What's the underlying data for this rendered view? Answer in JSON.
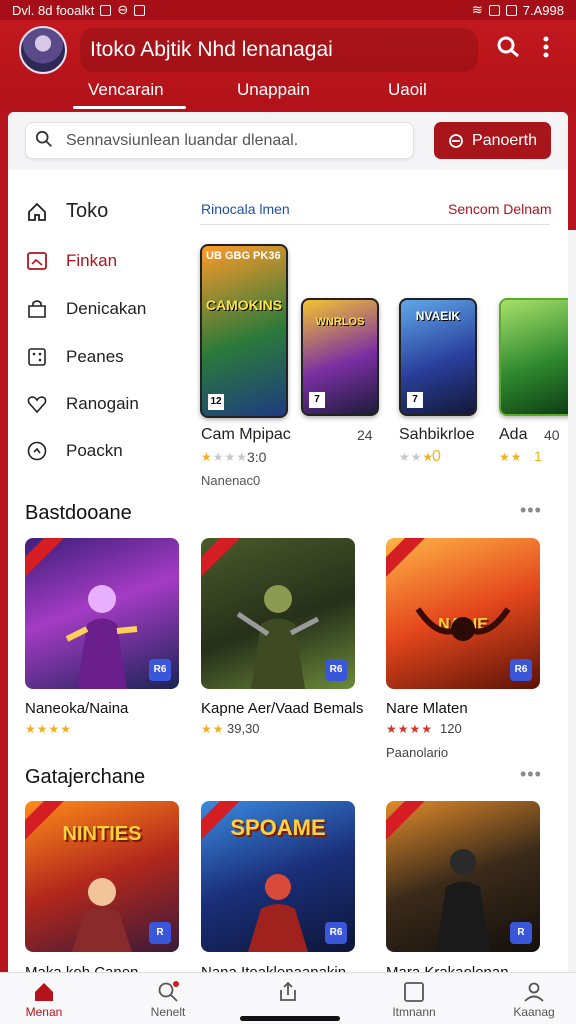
{
  "status_bar": {
    "left": "Dvl. 8d fooalkt",
    "time": "7.A998"
  },
  "header": {
    "title": "Itoko Abjtik Nhd lenanagai",
    "tabs": [
      {
        "label": "Vencarain",
        "active": true
      },
      {
        "label": "Unappain",
        "active": false
      },
      {
        "label": "Uaoil",
        "active": false
      }
    ]
  },
  "search": {
    "placeholder": "Sennavsiunlean luandar dlenaal.",
    "button_label": "Panoerth"
  },
  "sidebar": {
    "title": "Toko",
    "items": [
      {
        "label": "Finkan",
        "icon": "image-icon",
        "active": true
      },
      {
        "label": "Denicakan",
        "icon": "bag-icon",
        "active": false
      },
      {
        "label": "Peanes",
        "icon": "dice-icon",
        "active": false
      },
      {
        "label": "Ranogain",
        "icon": "heart-icon",
        "active": false
      },
      {
        "label": "Poackn",
        "icon": "clock-icon",
        "active": false
      }
    ]
  },
  "featured": {
    "left_link": "Rinocala lmen",
    "right_link": "Sencom Delnam",
    "cards": [
      {
        "cover_text": "CAMOKINS",
        "header_text": "UB GBG PK36",
        "badge": "12",
        "name": "Cam Mpipac",
        "extra": "24",
        "stars": 1,
        "rating": "3:0",
        "sub": "Nanenac0"
      },
      {
        "cover_text": "WNRLOS",
        "badge": "7",
        "name": "Sahbikrloe",
        "extra": "",
        "stars": 2,
        "rating": "0",
        "sub": ""
      },
      {
        "cover_text": "NVAEIK",
        "badge": "7",
        "name": "Ada",
        "extra": "40",
        "stars": 2,
        "rating": "1",
        "sub": ""
      },
      {
        "cover_text": "",
        "badge": "",
        "name": "",
        "extra": "",
        "stars": 0,
        "rating": "",
        "sub": ""
      }
    ]
  },
  "sections": [
    {
      "title": "Bastdooane",
      "games": [
        {
          "name": "Naneoka/Naina",
          "stars": 4,
          "rating": "",
          "sub": "",
          "tile_text": "",
          "corner": "R6"
        },
        {
          "name": "Kapne Aer/Vaad Bemals",
          "stars": 2,
          "rating": "39,30",
          "sub": "",
          "tile_text": "",
          "corner": "R6"
        },
        {
          "name": "Nare Mlaten",
          "stars": 4,
          "rating": "120",
          "sub": "Paanolario",
          "tile_text": "NAIHE",
          "corner": "R6"
        }
      ]
    },
    {
      "title": "Gatajerchane",
      "games": [
        {
          "name": "Maka koh Canen",
          "stars": 0,
          "rating": "",
          "sub": "",
          "tile_text": "NINTIES",
          "corner": "R"
        },
        {
          "name": "Nana Itoaklenaanakin",
          "stars": 0,
          "rating": "",
          "sub": "",
          "tile_text": "SPOAME",
          "corner": "R6"
        },
        {
          "name": "Mara Krakaolenan",
          "stars": 0,
          "rating": "",
          "sub": "",
          "tile_text": "",
          "corner": "R"
        }
      ]
    }
  ],
  "bottom_nav": [
    {
      "label": "Menan",
      "icon": "home-icon",
      "active": true
    },
    {
      "label": "Nenelt",
      "icon": "search-icon",
      "active": false
    },
    {
      "label": "",
      "icon": "share-icon",
      "active": false
    },
    {
      "label": "Itmnann",
      "icon": "square-icon",
      "active": false
    },
    {
      "label": "Kaanag",
      "icon": "profile-icon",
      "active": false
    }
  ],
  "colors": {
    "brand": "#b3141b",
    "star": "#f2b01e"
  }
}
